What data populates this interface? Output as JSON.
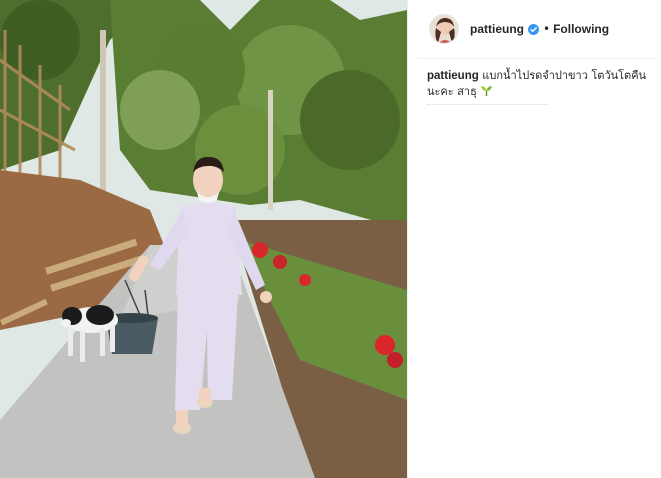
{
  "post": {
    "author": {
      "username": "pattieung",
      "verified": true,
      "verified_icon": "verified-badge-icon",
      "separator": "•",
      "follow_status": "Following"
    },
    "caption": {
      "username": "pattieung",
      "line1": "แบกน้ำไปรดจำปาขาว โตวันโตคืน",
      "line2": "นะคะ สาธุ",
      "emoji_icon": "seedling-icon"
    },
    "photo": {
      "subject": "photo"
    }
  },
  "colors": {
    "verified": "#3897f0",
    "text": "#262626",
    "divider": "#efefef"
  }
}
